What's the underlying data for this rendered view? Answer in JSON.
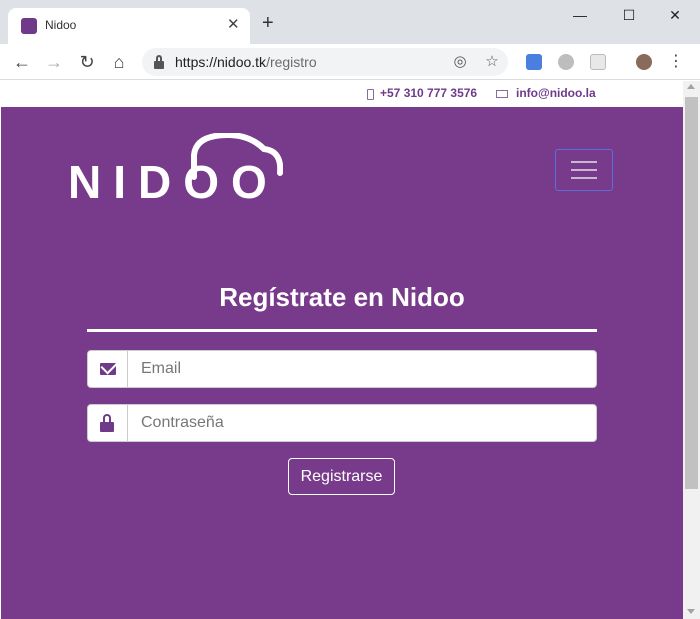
{
  "browser": {
    "tab": {
      "title": "Nidoo",
      "favicon": "nidoo-favicon"
    },
    "address_bar": {
      "host": "https://nidoo.tk",
      "path": "/registro"
    }
  },
  "contact": {
    "phone": "+57 310 777 3576",
    "email": "info@nidoo.la"
  },
  "header": {
    "logo_text": "NIDOO",
    "menu_icon": "hamburger-icon"
  },
  "form": {
    "title": "Regístrate en Nidoo",
    "email_placeholder": "Email",
    "password_placeholder": "Contraseña",
    "submit_label": "Registrarse"
  },
  "colors": {
    "brand_purple": "#783a8a",
    "accent_purple": "#6f3a8a",
    "menu_border": "#5a6fdc"
  }
}
